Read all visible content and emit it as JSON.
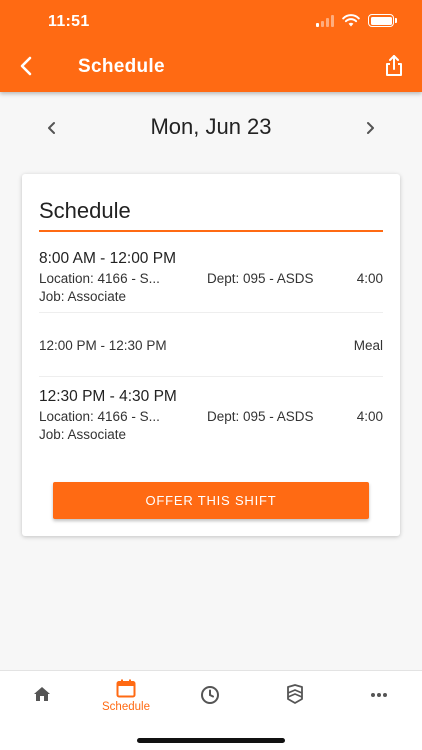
{
  "status_bar": {
    "time": "11:51"
  },
  "header": {
    "title": "Schedule"
  },
  "date_nav": {
    "date": "Mon, Jun 23"
  },
  "card": {
    "title": "Schedule",
    "shifts": [
      {
        "time": "8:00 AM - 12:00 PM",
        "location": "Location: 4166 - S...",
        "dept": "Dept: 095 - ASDS",
        "hours": "4:00",
        "job": "Job: Associate"
      },
      {
        "time": "12:30 PM - 4:30 PM",
        "location": "Location: 4166 - S...",
        "dept": "Dept: 095 - ASDS",
        "hours": "4:00",
        "job": "Job: Associate"
      }
    ],
    "meal": {
      "range": "12:00 PM - 12:30 PM",
      "type": "Meal"
    },
    "offer_button": "OFFER THIS SHIFT"
  },
  "tab_bar": {
    "tabs": [
      {
        "icon": "home-icon",
        "label": ""
      },
      {
        "icon": "calendar-icon",
        "label": "Schedule",
        "active": true
      },
      {
        "icon": "clock-icon",
        "label": ""
      },
      {
        "icon": "badge-icon",
        "label": ""
      },
      {
        "icon": "more-icon",
        "label": ""
      }
    ]
  },
  "colors": {
    "accent": "#ff6a13",
    "background": "#f7f7f7",
    "card": "#ffffff"
  }
}
